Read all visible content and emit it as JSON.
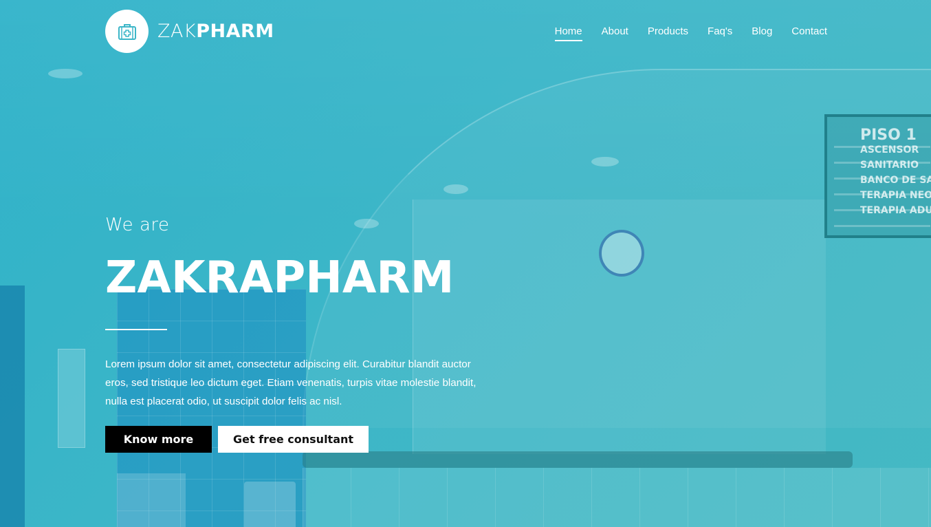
{
  "brand": {
    "name_light": "ZAK",
    "name_bold": "PHARM",
    "logo_icon": "medical-kit-icon",
    "accent": "#3cb6c8"
  },
  "nav": {
    "items": [
      {
        "label": "Home",
        "active": true
      },
      {
        "label": "About"
      },
      {
        "label": "Products"
      },
      {
        "label": "Faq's"
      },
      {
        "label": "Blog"
      },
      {
        "label": "Contact"
      }
    ]
  },
  "hero": {
    "kicker": "We are",
    "title": "ZAKRAPHARM",
    "description": "Lorem ipsum dolor sit amet, consectetur adipiscing elit. Curabitur blandit auctor eros, sed tristique leo dictum eget. Etiam venenatis, turpis vitae molestie blandit, nulla est placerat odio, ut suscipit dolor felis ac nisl.",
    "primary_button": "Know more",
    "secondary_button": "Get free consultant"
  },
  "background_sign": {
    "lines": [
      "PISO 1",
      "ASCENSOR",
      "SANITARIO",
      "BANCO DE SA",
      "TERAPIA NEO",
      "TERAPIA ADU"
    ]
  }
}
